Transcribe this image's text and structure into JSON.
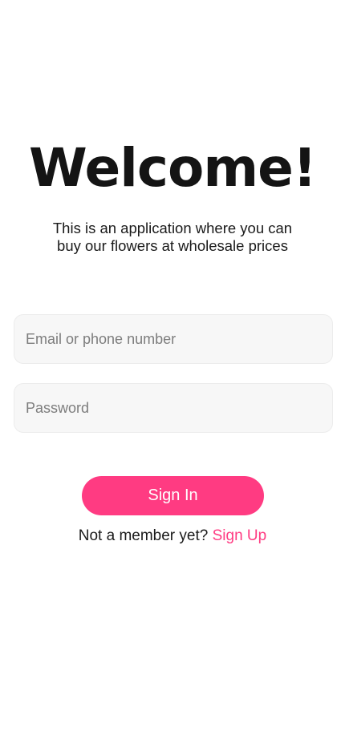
{
  "header": {
    "title": "Welcome!",
    "subtitle": "This is an application where you can buy our flowers at wholesale prices"
  },
  "form": {
    "email_placeholder": "Email or phone number",
    "email_value": "",
    "password_placeholder": "Password",
    "password_value": "",
    "signin_label": "Sign In"
  },
  "footer": {
    "prompt": "Not a member yet?",
    "signup_label": "Sign Up"
  },
  "colors": {
    "accent": "#ff3b82",
    "background": "#ffffff",
    "field_background": "#f7f7f7",
    "text": "#141414"
  }
}
